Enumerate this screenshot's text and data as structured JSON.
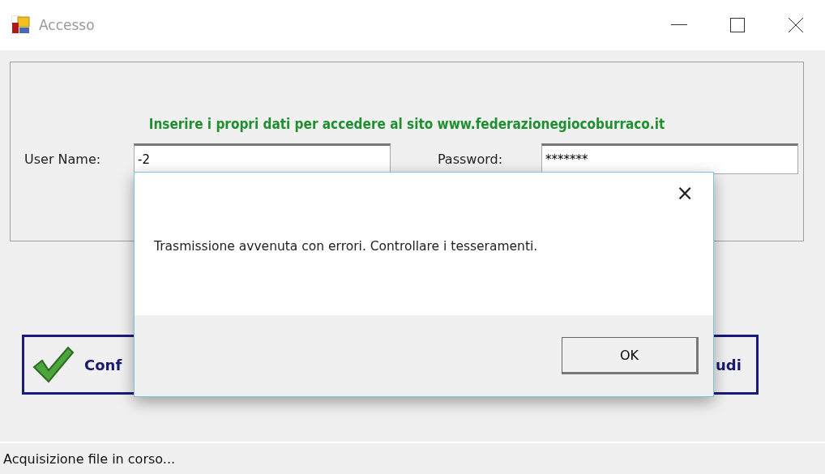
{
  "window": {
    "title": "Accesso"
  },
  "form": {
    "heading": "Inserire i propri dati per accedere al sito www.federazionegiocoburraco.it",
    "fields": [
      {
        "label": "User Name:",
        "value": "-2"
      },
      {
        "label": "Password:",
        "value": "*******"
      }
    ]
  },
  "buttons": [
    {
      "label": "Conf",
      "kind": "confirm"
    },
    {
      "label": "udi",
      "kind": "close"
    }
  ],
  "status_bar": "Acquisizione file in corso...",
  "dialog": {
    "message": "Trasmissione avvenuta con errori. Controllare i tesseramenti.",
    "close": "×",
    "button": "OK"
  }
}
